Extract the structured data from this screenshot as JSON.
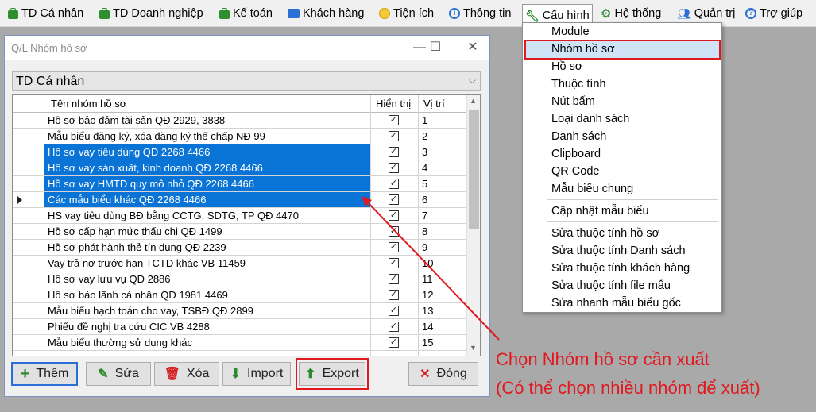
{
  "menubar": {
    "items": [
      {
        "label": "TD Cá nhân",
        "icon": "briefcase-icon"
      },
      {
        "label": "TD Doanh nghiệp",
        "icon": "briefcase-icon"
      },
      {
        "label": "Kế toán",
        "icon": "briefcase-icon"
      },
      {
        "label": "Khách hàng",
        "icon": "contact-card-icon"
      },
      {
        "label": "Tiện ích",
        "icon": "smiley-icon"
      },
      {
        "label": "Thông tin",
        "icon": "info-icon"
      },
      {
        "label": "Cấu hình",
        "icon": "wrench-icon"
      },
      {
        "label": "Hệ thống",
        "icon": "gear-icon"
      },
      {
        "label": "Quản trị",
        "icon": "users-icon"
      },
      {
        "label": "Trợ giúp",
        "icon": "help-icon"
      }
    ]
  },
  "dropdown": {
    "items": [
      "Module",
      "Nhóm hồ sơ",
      "Hồ sơ",
      "Thuộc tính",
      "Nút bấm",
      "Loại danh sách",
      "Danh sách",
      "Clipboard",
      "QR Code",
      "Mẫu biểu chung",
      "Cập nhật mẫu biểu",
      "Sửa thuộc tính hồ sơ",
      "Sửa thuộc tính Danh sách",
      "Sửa thuộc tính khách hàng",
      "Sửa thuộc tính file mẫu",
      "Sửa nhanh mẫu biểu gốc"
    ],
    "highlighted": "Nhóm hồ sơ"
  },
  "window": {
    "title": "Q/L Nhóm hồ sơ",
    "combo_value": "TD Cá nhân",
    "columns": {
      "name": "Tên nhóm hồ sơ",
      "show": "Hiển thị",
      "pos": "Vị trí"
    },
    "rows": [
      {
        "name": "Hồ sơ bảo đảm tài sản QĐ 2929, 3838",
        "pos": "1",
        "checked": true,
        "selected": false
      },
      {
        "name": "Mẫu biểu đăng ký, xóa đăng ký thế chấp NĐ 99",
        "pos": "2",
        "checked": true,
        "selected": false
      },
      {
        "name": "Hồ sơ vay tiêu dùng QĐ 2268 4466",
        "pos": "3",
        "checked": true,
        "selected": true
      },
      {
        "name": "Hồ sơ vay sản xuất, kinh doanh QĐ 2268 4466",
        "pos": "4",
        "checked": true,
        "selected": true
      },
      {
        "name": "Hồ sơ vay HMTD quy mô nhỏ QĐ 2268 4466",
        "pos": "5",
        "checked": true,
        "selected": true
      },
      {
        "name": "Các mẫu biểu khác QĐ 2268 4466",
        "pos": "6",
        "checked": true,
        "selected": true,
        "current": true
      },
      {
        "name": "HS vay tiêu dùng BĐ bằng CCTG, SDTG, TP QĐ 4470",
        "pos": "7",
        "checked": true,
        "selected": false
      },
      {
        "name": "Hồ sơ cấp hạn mức thấu chi QĐ 1499",
        "pos": "8",
        "checked": true,
        "selected": false
      },
      {
        "name": "Hồ sơ phát hành thẻ tín dụng QĐ 2239",
        "pos": "9",
        "checked": true,
        "selected": false
      },
      {
        "name": "Vay trả nợ trước hạn TCTD khác VB 11459",
        "pos": "10",
        "checked": true,
        "selected": false
      },
      {
        "name": "Hồ sơ vay lưu vụ QĐ 2886",
        "pos": "11",
        "checked": true,
        "selected": false
      },
      {
        "name": "Hồ sơ bảo lãnh cá nhân QĐ 1981 4469",
        "pos": "12",
        "checked": true,
        "selected": false
      },
      {
        "name": "Mẫu biểu hạch toán cho vay, TSBĐ QĐ 2899",
        "pos": "13",
        "checked": true,
        "selected": false
      },
      {
        "name": "Phiếu đề nghị tra cứu CIC VB 4288",
        "pos": "14",
        "checked": true,
        "selected": false
      },
      {
        "name": "Mẫu biểu thường sử dụng khác",
        "pos": "15",
        "checked": true,
        "selected": false
      }
    ],
    "buttons": {
      "add": "Thêm",
      "edit": "Sửa",
      "delete": "Xóa",
      "import": "Import",
      "export": "Export",
      "close": "Đóng"
    }
  },
  "annotation": {
    "line1": "Chọn Nhóm hồ sơ cần xuất",
    "line2": "(Có thể chọn nhiều nhóm để xuất)",
    "color": "#e0191e"
  },
  "colors": {
    "selection": "#0a74d6",
    "highlight": "#cfe4f7",
    "accent_red": "#e0191e"
  }
}
